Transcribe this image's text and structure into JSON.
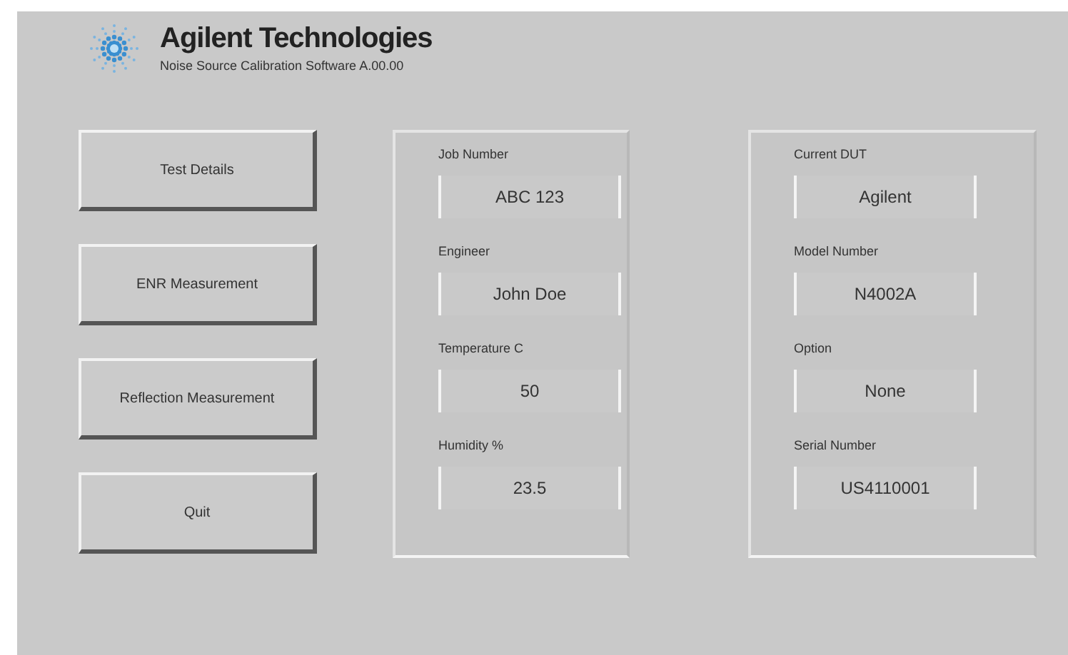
{
  "header": {
    "title": "Agilent Technologies",
    "subtitle": "Noise Source Calibration Software A.00.00"
  },
  "buttons": [
    "Test Details",
    "ENR Measurement",
    "Reflection Measurement",
    "Quit"
  ],
  "panels": [
    {
      "fields": [
        {
          "label": "Job Number",
          "value": "ABC 123"
        },
        {
          "label": "Engineer",
          "value": "John Doe"
        },
        {
          "label": "Temperature C",
          "value": "50"
        },
        {
          "label": "Humidity %",
          "value": "23.5"
        }
      ]
    },
    {
      "fields": [
        {
          "label": "Current DUT",
          "value": "Agilent"
        },
        {
          "label": "Model Number",
          "value": "N4002A"
        },
        {
          "label": "Option",
          "value": "None"
        },
        {
          "label": "Serial Number",
          "value": "US4110001"
        }
      ]
    }
  ]
}
